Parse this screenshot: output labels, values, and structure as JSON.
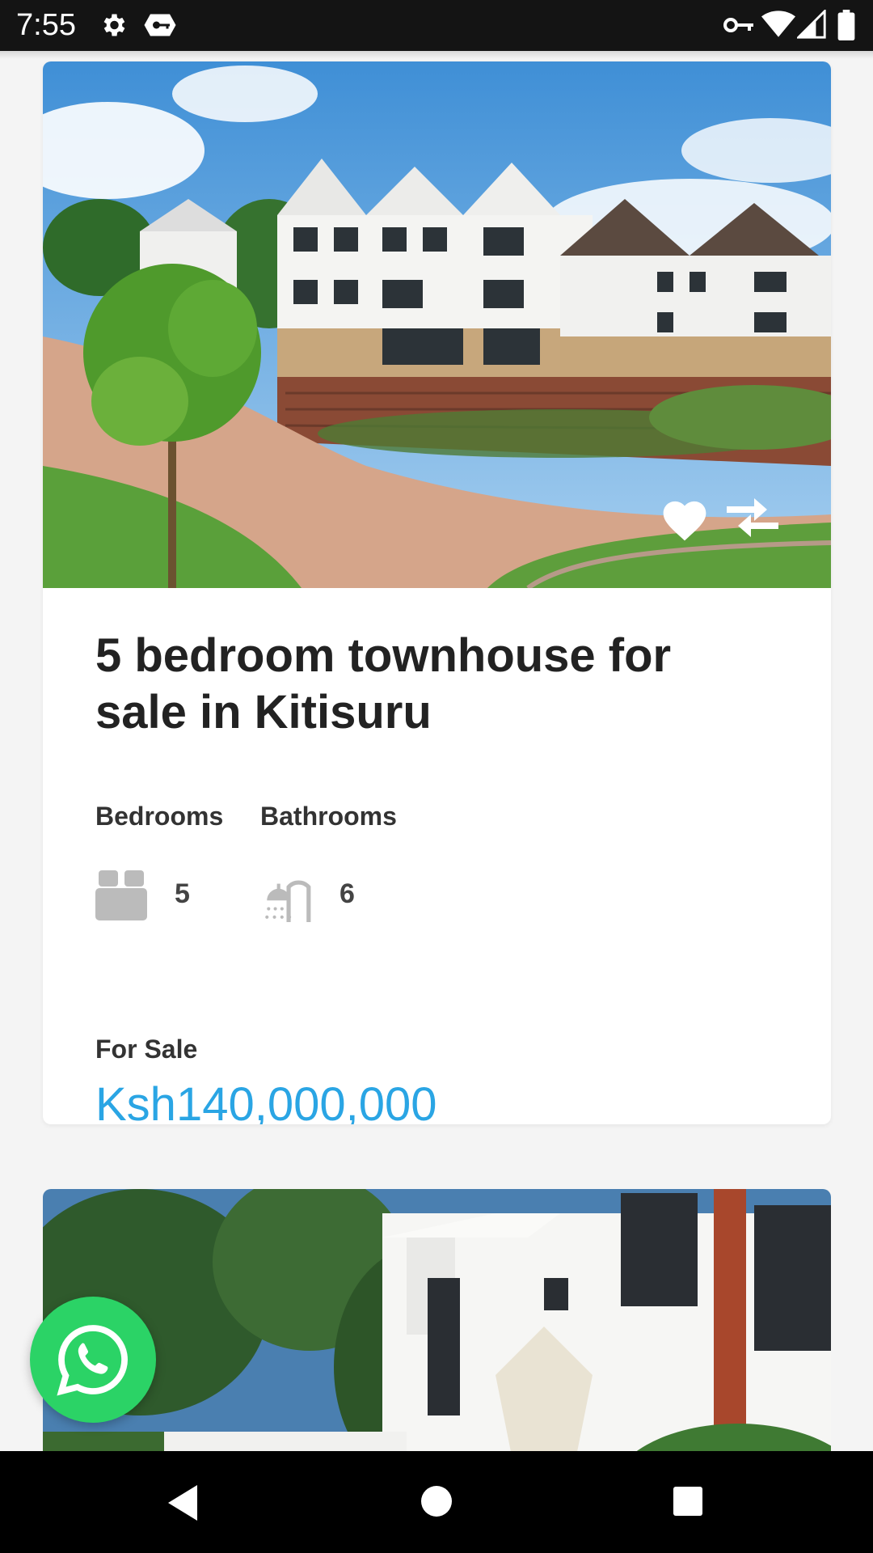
{
  "status_bar": {
    "time": "7:55"
  },
  "listing": {
    "title": "5 bedroom townhouse for sale in Kitisuru",
    "bedrooms_label": "Bedrooms",
    "bathrooms_label": "Bathrooms",
    "bedrooms": "5",
    "bathrooms": "6",
    "status": "For Sale",
    "price": "Ksh140,000,000"
  },
  "colors": {
    "price": "#2aa5e4",
    "whatsapp": "#2bd366"
  },
  "icons": {
    "favorite": "heart-icon",
    "compare": "compare-arrows-icon",
    "bedrooms": "bed-icon",
    "bathrooms": "shower-icon",
    "chat": "whatsapp-icon"
  }
}
